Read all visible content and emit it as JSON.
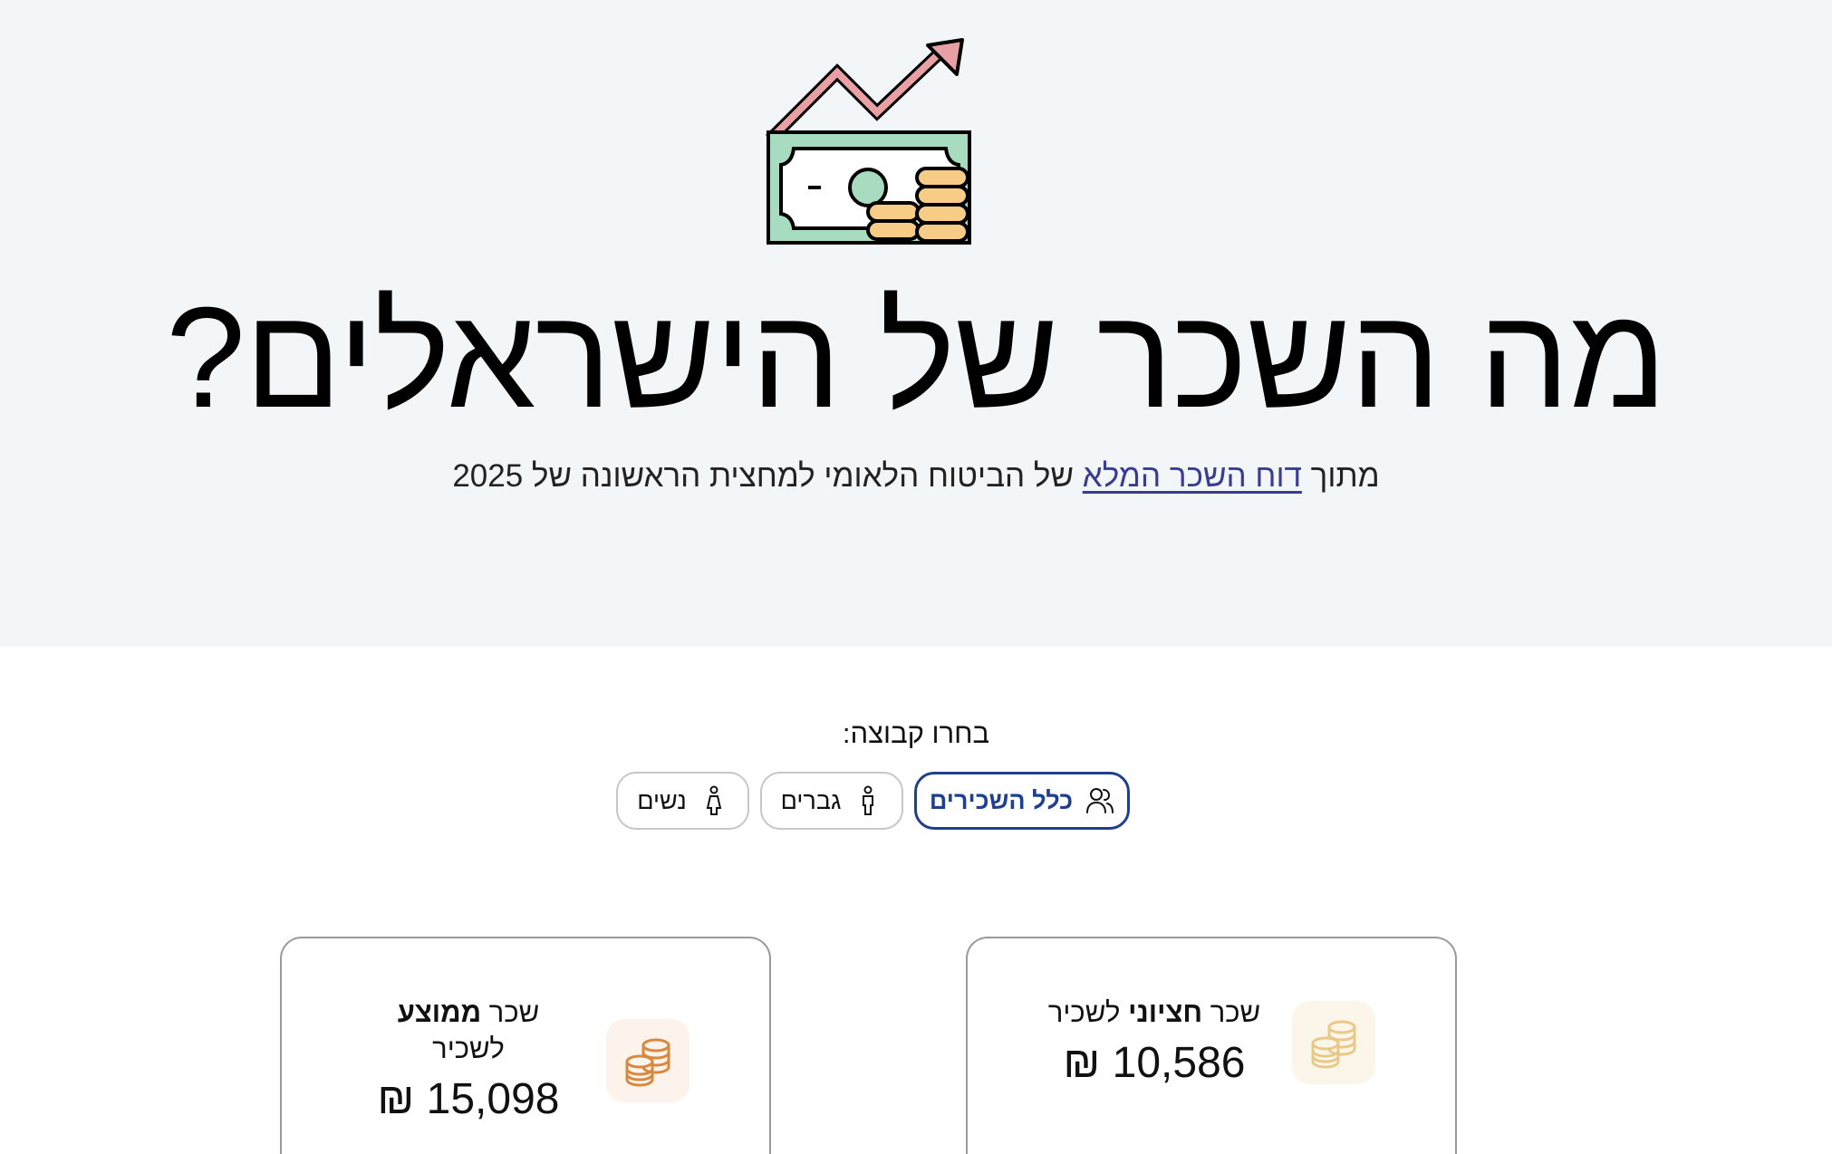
{
  "hero": {
    "title": "מה השכר של הישראלים?",
    "subtitle_prefix": "מתוך",
    "subtitle_link": "דוח השכר המלא",
    "subtitle_suffix": "של הביטוח הלאומי למחצית הראשונה של 2025",
    "icon": "money-growth-icon"
  },
  "group_picker": {
    "label": "בחרו קבוצה:",
    "options": [
      {
        "label": "כלל השכירים",
        "icon": "people-icon",
        "selected": true
      },
      {
        "label": "גברים",
        "icon": "man-icon",
        "selected": false
      },
      {
        "label": "נשים",
        "icon": "woman-icon",
        "selected": false
      }
    ]
  },
  "cards": {
    "median": {
      "label_prefix": "שכר",
      "label_bold": "חציוני",
      "label_suffix": "לשכיר",
      "value": "10,586 ₪",
      "icon": "coins-icon",
      "accent": "#e8c98a"
    },
    "average": {
      "label_prefix": "שכר",
      "label_bold": "ממוצע",
      "label_suffix": "לשכיר",
      "value": "15,098 ₪",
      "icon": "coins-icon",
      "accent": "#d9893e"
    }
  },
  "colors": {
    "hero_bg": "#f3f6f9",
    "link": "#3a3d8f",
    "selected_pill": "#1f3f8f",
    "bill_green": "#a8dcc0",
    "arrow_pink": "#e8a0a4",
    "coin_yellow": "#f6cc86"
  }
}
